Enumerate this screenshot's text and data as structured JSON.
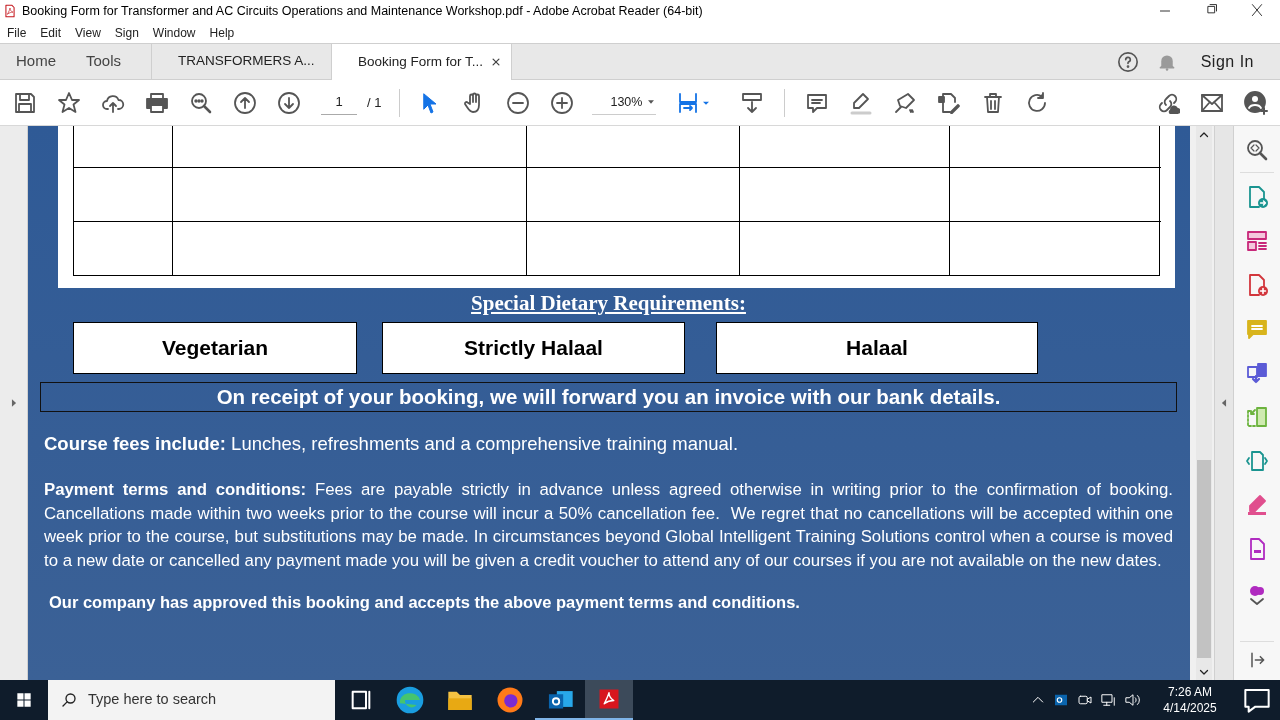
{
  "window": {
    "title": "Booking Form for Transformer and AC Circuits Operations and Maintenance Workshop.pdf - Adobe Acrobat Reader (64-bit)"
  },
  "menu": [
    "File",
    "Edit",
    "View",
    "Sign",
    "Window",
    "Help"
  ],
  "tabs": [
    {
      "label": "Home",
      "kind": "nav",
      "selected": false
    },
    {
      "label": "Tools",
      "kind": "nav",
      "selected": false
    },
    {
      "label": "TRANSFORMERS A...",
      "kind": "doc",
      "selected": false
    },
    {
      "label": "Booking Form for T...",
      "kind": "doc",
      "selected": true,
      "closable": true
    }
  ],
  "sign_in": "Sign In",
  "toolbar": {
    "page": "1",
    "page_total": "/ 1",
    "zoom": "130%"
  },
  "document": {
    "dietary_heading": "Special Dietary Requirements:",
    "dietary_options": [
      "Vegetarian",
      "Strictly Halaal",
      "Halaal"
    ],
    "banner": "On receipt of your booking, we will forward you an invoice with our bank details.",
    "paragraphs": [
      "**Course fees include:** Lunches, refreshments and a comprehensive training manual.",
      "**Payment terms and conditions:** Fees are payable strictly in advance unless agreed otherwise in writing prior to the confirmation of booking. Cancellations made within two weeks prior to the course will incur a 50% cancellation fee.  We regret that no cancellations will be accepted within one week prior to the course, but substitutions may be made. In circumstances beyond Global Intelligent Training Solutions control when a course is moved to a new date or cancelled any payment made you will be given a credit voucher to attend any of our courses if you are not available on the new dates."
    ],
    "approval": "Our company has approved this booking and accepts the above payment terms and conditions."
  },
  "taskbar": {
    "search_placeholder": "Type here to search",
    "time": "7:26 AM",
    "date": "4/14/2025"
  }
}
